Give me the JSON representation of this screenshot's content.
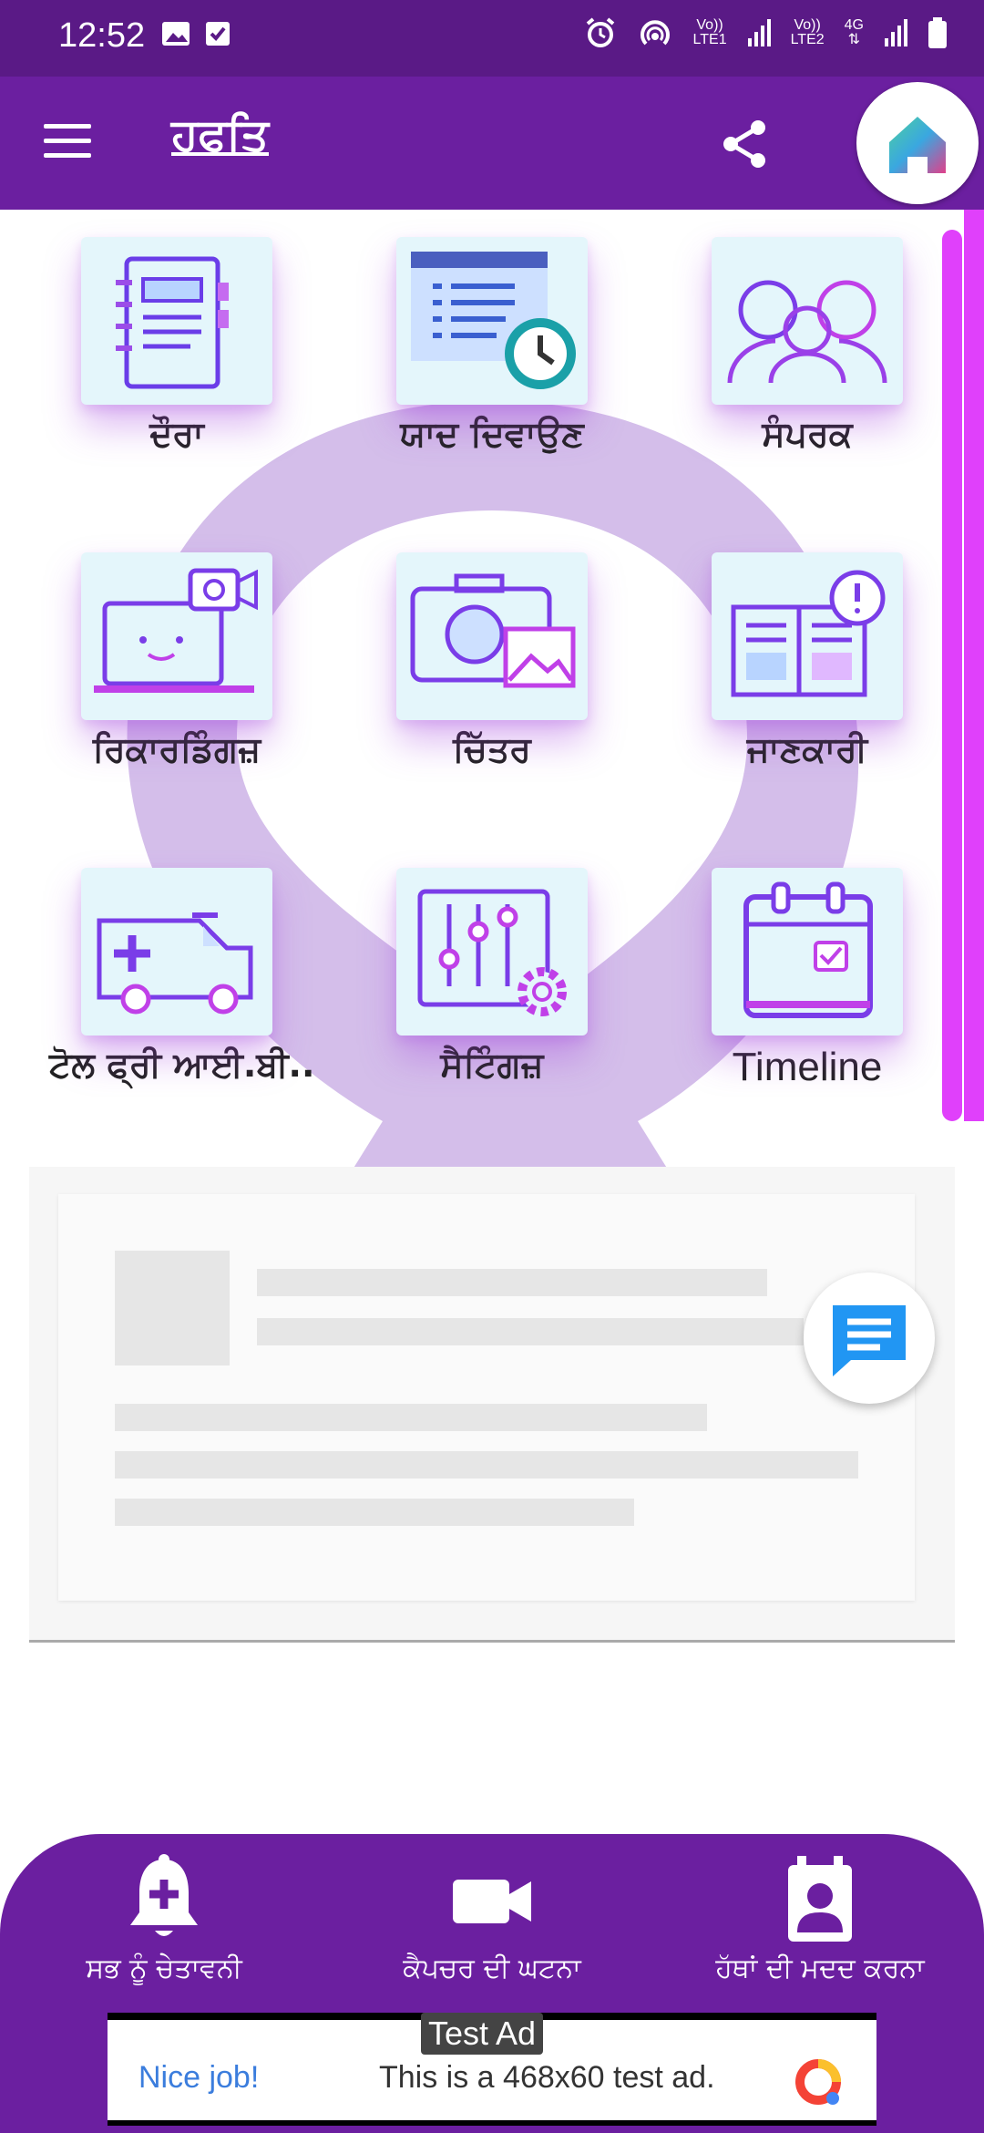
{
  "status_bar": {
    "time": "12:52",
    "sim1": "LTE1",
    "sim2": "LTE2",
    "network": "4G",
    "volte": "Vo))"
  },
  "app_bar": {
    "title": "ਹਫਤਿ"
  },
  "grid": [
    {
      "label": "ਦੌਰਾ",
      "icon": "notebook-icon"
    },
    {
      "label": "ਯਾਦ ਦਿਵਾਉਣ",
      "icon": "reminder-clock-icon"
    },
    {
      "label": "ਸੰਪਰਕ",
      "icon": "contacts-people-icon"
    },
    {
      "label": "ਰਿਕਾਰਡਿੰਗਜ਼",
      "icon": "laptop-video-icon"
    },
    {
      "label": "ਚਿੱਤਰ",
      "icon": "camera-photo-icon"
    },
    {
      "label": "ਜਾਣਕਾਰੀ",
      "icon": "book-info-icon"
    },
    {
      "label": "ਟੋਲ ਫ੍ਰੀ ਆਈ.ਬੀ..",
      "icon": "ambulance-icon"
    },
    {
      "label": "ਸੈਟਿੰਗਜ਼",
      "icon": "settings-sliders-icon"
    },
    {
      "label": "Timeline",
      "icon": "calendar-icon"
    }
  ],
  "bottom_nav": [
    {
      "label": "ਸਭ ਨੂੰ ਚੇਤਾਵਨੀ",
      "icon": "alert-bell-icon"
    },
    {
      "label": "ਕੈਪਚਰ ਦੀ ਘਟਨਾ",
      "icon": "video-camera-icon"
    },
    {
      "label": "ਹੱਥਾਂ ਦੀ ਮਦਦ ਕਰਨਾ",
      "icon": "contact-card-icon"
    }
  ],
  "ad_banner": {
    "tag": "Test Ad",
    "headline": "Nice job!",
    "message": "This is a 468x60 test ad."
  },
  "colors": {
    "primary": "#6b1fa0",
    "status_bar": "#5a1a86",
    "accent": "#e040fb",
    "tile_bg": "#e4f6fb"
  }
}
